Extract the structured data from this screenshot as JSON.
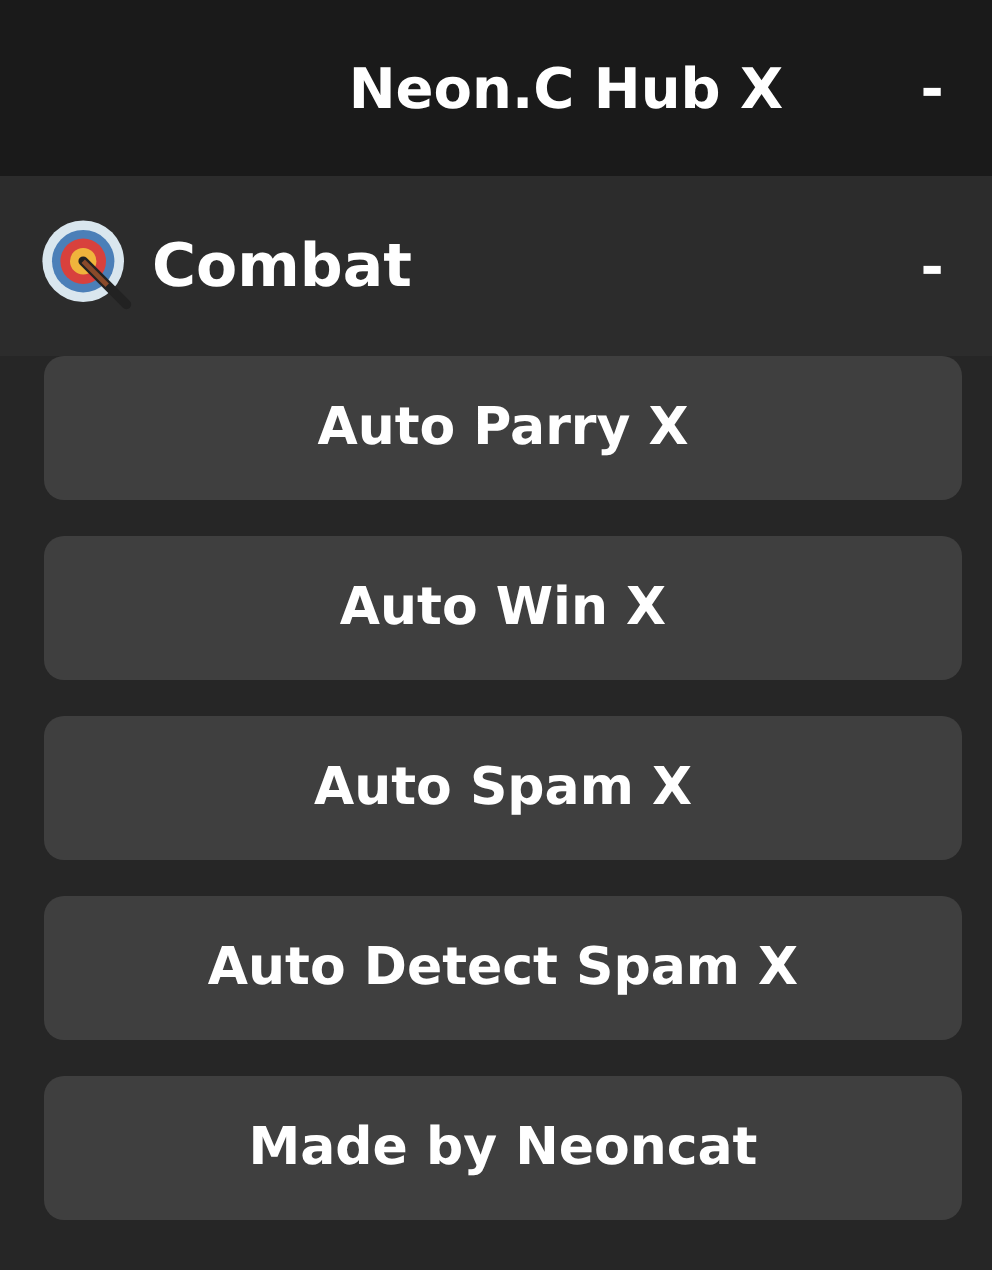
{
  "window": {
    "title": "Neon.C Hub X",
    "minimize": "-"
  },
  "section": {
    "title": "Combat",
    "collapse": "-"
  },
  "buttons": [
    {
      "label": "Auto Parry X"
    },
    {
      "label": "Auto Win X"
    },
    {
      "label": "Auto Spam X"
    },
    {
      "label": "Auto Detect Spam X"
    },
    {
      "label": "Made by Neoncat"
    }
  ]
}
